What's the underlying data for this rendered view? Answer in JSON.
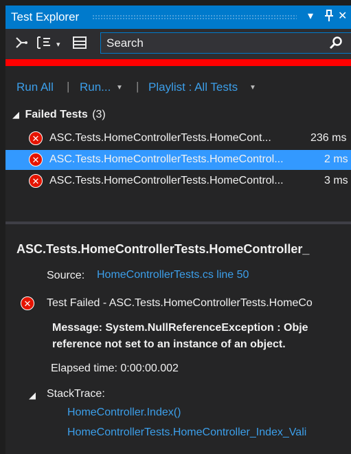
{
  "window": {
    "title": "Test Explorer",
    "buttons": {
      "dropdown": "▾",
      "pin": "ᵽ",
      "close": "✕"
    }
  },
  "toolbar": {
    "search_placeholder": "Search",
    "icons": [
      "group-by-icon",
      "playlist-icon",
      "collapse-icon",
      "search-icon"
    ]
  },
  "commands": {
    "run_all": "Run All",
    "run": "Run...",
    "playlist": "Playlist : All Tests"
  },
  "tests": {
    "group_label": "Failed Tests",
    "group_count": "(3)",
    "items": [
      {
        "name": "ASC.Tests.HomeControllerTests.HomeCont...",
        "duration": "236 ms",
        "selected": false
      },
      {
        "name": "ASC.Tests.HomeControllerTests.HomeControl...",
        "duration": "2 ms",
        "selected": true
      },
      {
        "name": "ASC.Tests.HomeControllerTests.HomeControl...",
        "duration": "3 ms",
        "selected": false
      }
    ]
  },
  "details": {
    "title": "ASC.Tests.HomeControllerTests.HomeController_",
    "source_label": "Source:",
    "source_link": "HomeControllerTests.cs line 50",
    "result": "Test Failed - ASC.Tests.HomeControllerTests.HomeCo",
    "message_line1": "Message: System.NullReferenceException : Obje",
    "message_line2": "reference not set to an instance of an object.",
    "elapsed": "Elapsed time: 0:00:00.002",
    "stacktrace_label": "StackTrace:",
    "stack": [
      "HomeController.Index()",
      "HomeControllerTests.HomeController_Index_Vali"
    ]
  },
  "colors": {
    "accent": "#007acc",
    "selection": "#3399ff",
    "error": "#e51400",
    "link": "#3c9fea",
    "highlight_bar": "#ff0000"
  }
}
